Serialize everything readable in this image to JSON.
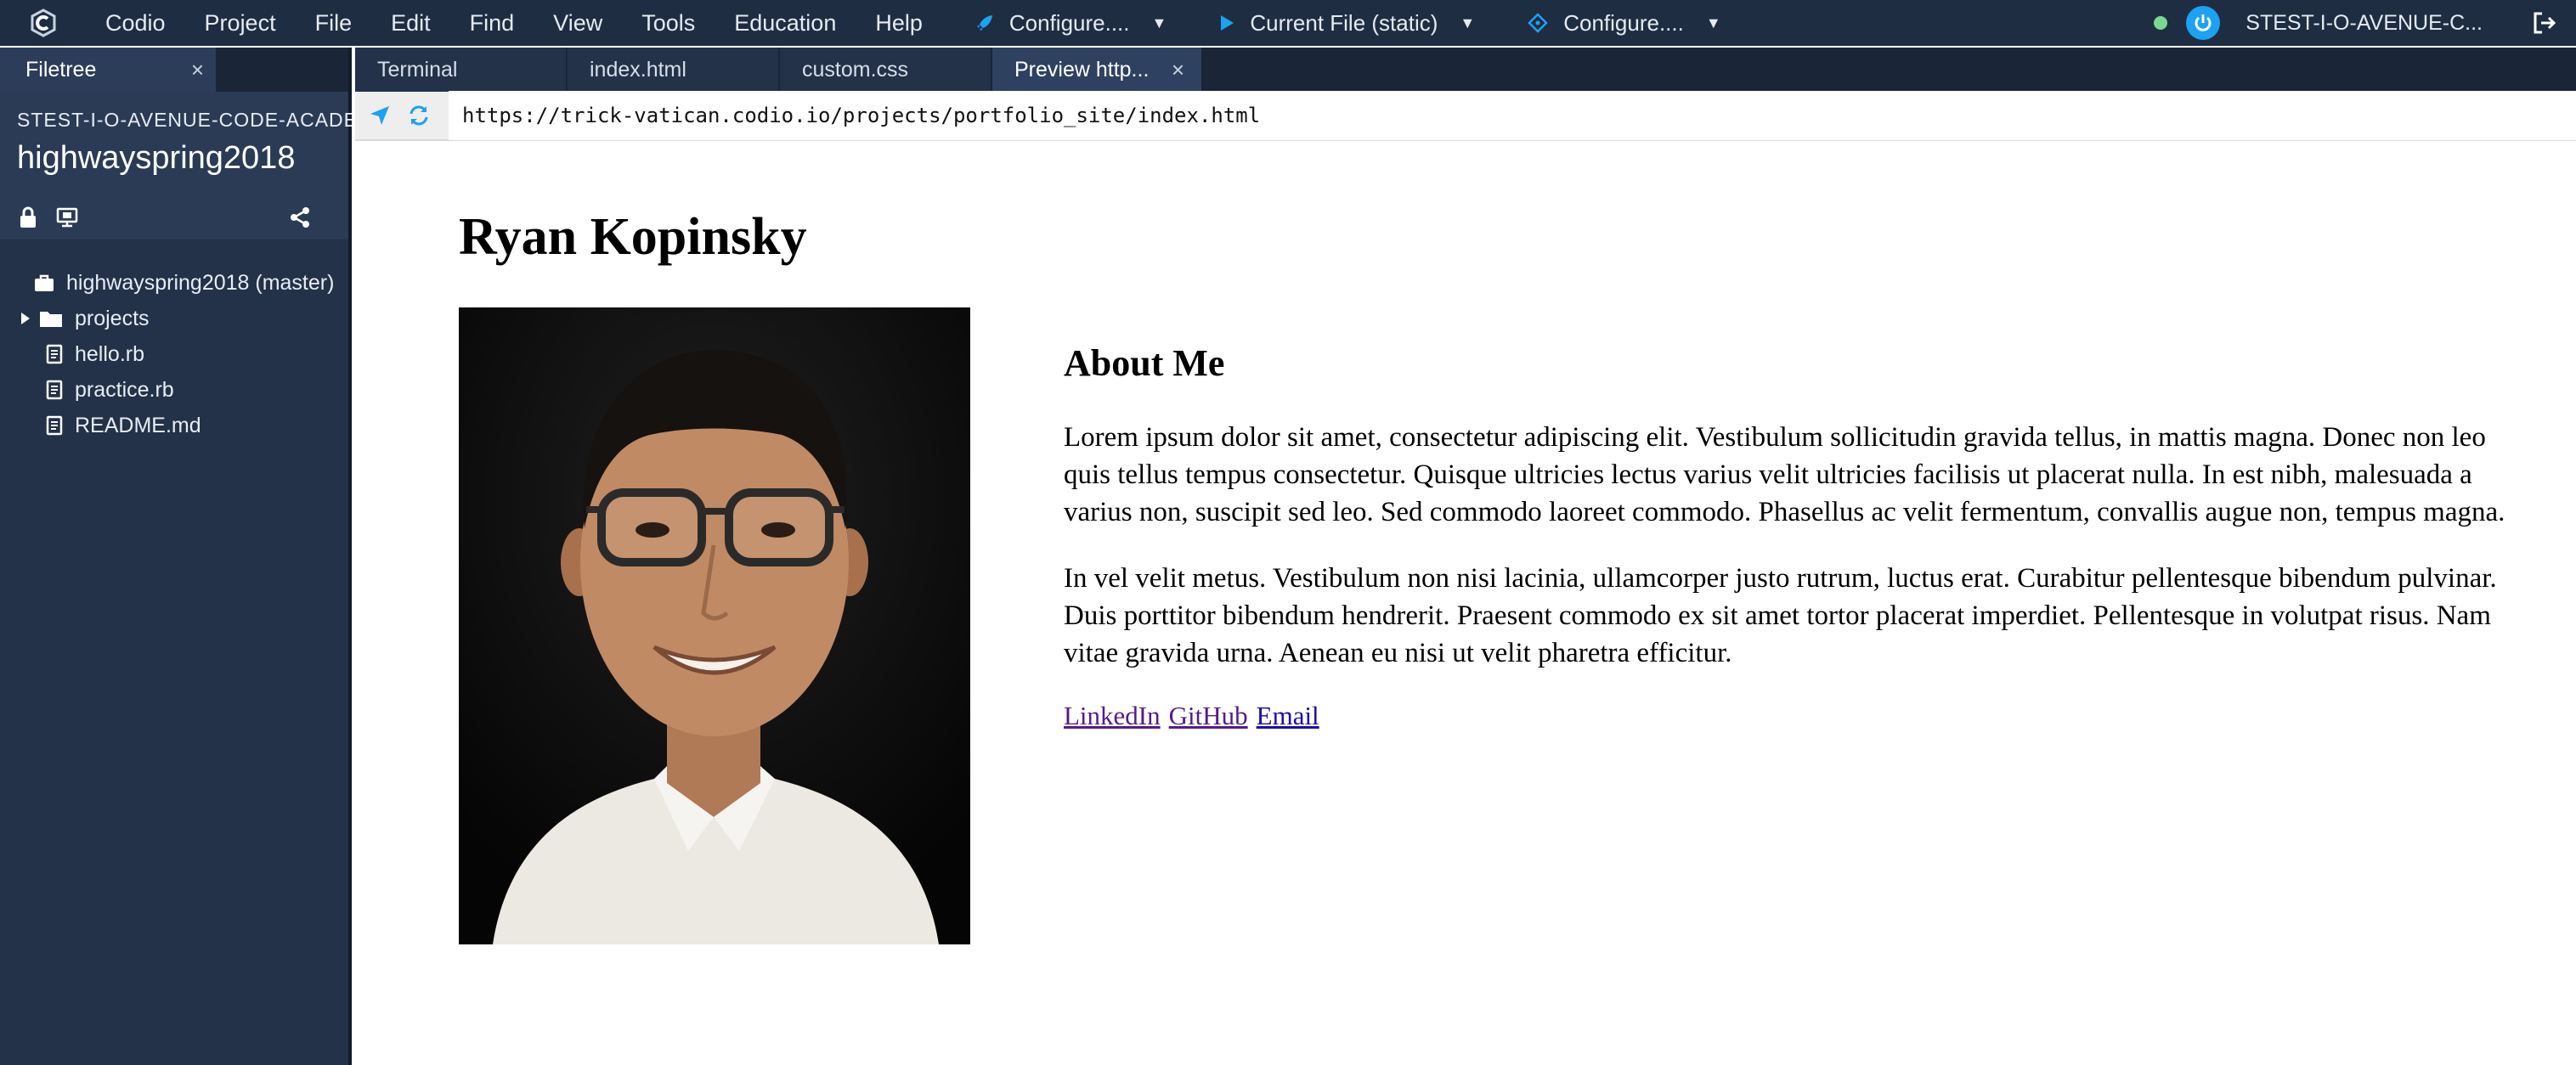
{
  "app": {
    "menu": [
      "Codio",
      "Project",
      "File",
      "Edit",
      "Find",
      "View",
      "Tools",
      "Education",
      "Help"
    ],
    "run_groups": [
      {
        "label": "Configure....",
        "icon": "rocket-icon"
      },
      {
        "label": "Current File (static)",
        "icon": "play-icon"
      },
      {
        "label": "Configure....",
        "icon": "debug-icon"
      }
    ],
    "user": "STEST-I-O-AVENUE-C...",
    "colors": {
      "accent": "#1da1f2",
      "bar": "#1f2d43",
      "panel": "#233149",
      "status": "#7bd88f"
    }
  },
  "sidebar": {
    "tab_label": "Filetree",
    "owner": "STEST-I-O-AVENUE-CODE-ACADEMY",
    "project": "highwayspring2018",
    "tree": [
      {
        "label": "highwayspring2018 (master)",
        "type": "repo"
      },
      {
        "label": "projects",
        "type": "folder"
      },
      {
        "label": "hello.rb",
        "type": "file"
      },
      {
        "label": "practice.rb",
        "type": "file"
      },
      {
        "label": "README.md",
        "type": "file"
      }
    ]
  },
  "editor": {
    "tabs": [
      "Terminal",
      "index.html",
      "custom.css",
      "Preview http..."
    ]
  },
  "preview": {
    "url": "https://trick-vatican.codio.io/projects/portfolio_site/index.html",
    "title": "Ryan Kopinsky",
    "heading": "About Me",
    "paragraphs": [
      "Lorem ipsum dolor sit amet, consectetur adipiscing elit. Vestibulum sollicitudin gravida tellus, in mattis magna. Donec non leo quis tellus tempus consectetur. Quisque ultricies lectus varius velit ultricies facilisis ut placerat nulla. In est nibh, malesuada a varius non, suscipit sed leo. Sed commodo laoreet commodo. Phasellus ac velit fermentum, convallis augue non, tempus magna.",
      "In vel velit metus. Vestibulum non nisi lacinia, ullamcorper justo rutrum, luctus erat. Curabitur pellentesque bibendum pulvinar. Duis porttitor bibendum hendrerit. Praesent commodo ex sit amet tortor placerat imperdiet. Pellentesque in volutpat risus. Nam vitae gravida urna. Aenean eu nisi ut velit pharetra efficitur."
    ],
    "links": [
      "LinkedIn",
      "GitHub",
      "Email"
    ]
  }
}
